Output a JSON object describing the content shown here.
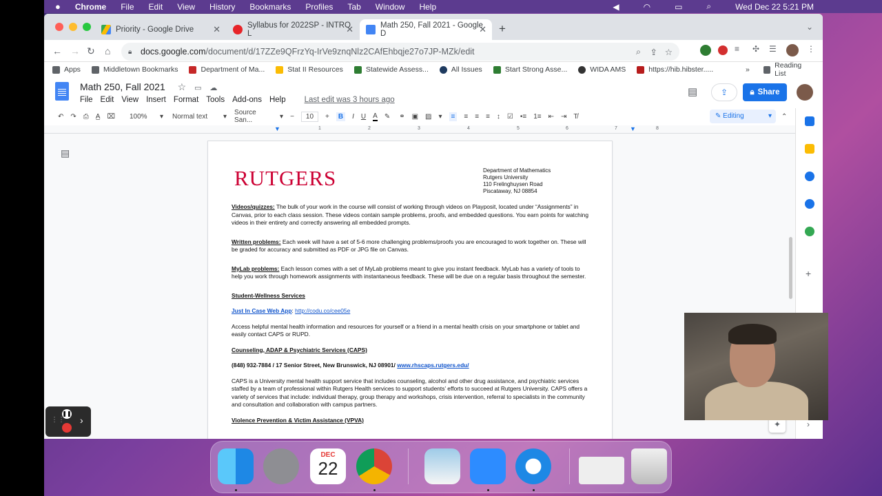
{
  "menubar": {
    "apple": "",
    "app": "Chrome",
    "items": [
      "File",
      "Edit",
      "View",
      "History",
      "Bookmarks",
      "Profiles",
      "Tab",
      "Window",
      "Help"
    ],
    "clock": "Wed Dec 22  5:21 PM"
  },
  "tabs": [
    {
      "label": "Priority - Google Drive"
    },
    {
      "label": "Syllabus for 2022SP - INTRO L"
    },
    {
      "label": "Math 250, Fall 2021 - Google D"
    }
  ],
  "address": {
    "url_host": "docs.google.com",
    "url_path": "/document/d/17ZZe9QFrzYq-IrVe9znqNlz2CAfEhbqje27o7JP-MZk/edit"
  },
  "bookmarks": [
    "Apps",
    "Middletown Bookmarks",
    "Department of Ma...",
    "Stat II Resources",
    "Statewide Assess...",
    "All Issues",
    "Start Strong Asse...",
    "WIDA AMS",
    "https://hib.hibster....."
  ],
  "reading_list": "Reading List",
  "doc": {
    "title": "Math 250, Fall 2021",
    "menus": [
      "File",
      "Edit",
      "View",
      "Insert",
      "Format",
      "Tools",
      "Add-ons",
      "Help"
    ],
    "last_edit": "Last edit was 3 hours ago",
    "share": "Share"
  },
  "toolbar": {
    "zoom": "100%",
    "style": "Normal text",
    "font": "Source San...",
    "size": "10",
    "mode": "Editing"
  },
  "ruler": [
    "1",
    "2",
    "3",
    "4",
    "5",
    "6",
    "7",
    "8"
  ],
  "page": {
    "logo": "RUTGERS",
    "address": [
      "Department of Mathematics",
      "Rutgers University",
      "110 Frelinghuysen Road",
      "Piscataway, NJ 08854"
    ],
    "p1_head": "Videos/quizzes:",
    "p1": " The bulk of your work in the course will consist of working through videos on Playposit, located under “Assignments” in Canvas, prior to each class session.  These videos contain sample problems, proofs, and embedded questions.  You earn points for watching videos in their entirety and correctly answering all embedded prompts.",
    "p2_head": "Written problems:",
    "p2": " Each week will have a set of 5-6 more challenging problems/proofs you are encouraged to work together on.  These will be graded for accuracy and submitted as PDF or JPG file on Canvas.",
    "p3_head": "MyLab problems:",
    "p3": " Each lesson comes with a set of MyLab problems meant to give you instant feedback.  MyLab has a variety of tools to help you work through homework assignments with instantaneous feedback.  These will be due on a regular basis throughout the semester.",
    "h_wellness": "Student-Wellness Services",
    "jic": "Just In Case Web App",
    "jic_sep": ": ",
    "jic_url": "http://codu.co/cee05e",
    "p4": "Access helpful mental health information and resources for yourself or a friend in a mental health crisis on your smartphone or tablet and easily contact CAPS or RUPD.",
    "h_caps": "Counseling, ADAP & Psychiatric Services (CAPS)",
    "caps_contact": "(848) 932-7884 / 17 Senior Street, New Brunswick, NJ 08901/ ",
    "caps_url": "www.rhscaps.rutgers.edu/",
    "p5": "CAPS is a University mental health support service that includes counseling, alcohol and other drug assistance, and psychiatric services staffed by a team of professional within Rutgers Health services to support students’ efforts to succeed at Rutgers University. CAPS offers a variety of services that include: individual therapy, group therapy and workshops, crisis intervention, referral to specialists in the community and consultation and collaboration with campus partners.",
    "h_vpva": "Violence Prevention & Victim Assistance (VPVA)"
  },
  "dock": {
    "calendar_month": "DEC",
    "calendar_day": "22"
  },
  "icons": [
    "apple-icon",
    "finder-icon",
    "settings-icon",
    "calendar-icon",
    "chrome-icon",
    "preview-icon",
    "zoom-icon",
    "safari-icon",
    "trash-icon"
  ]
}
